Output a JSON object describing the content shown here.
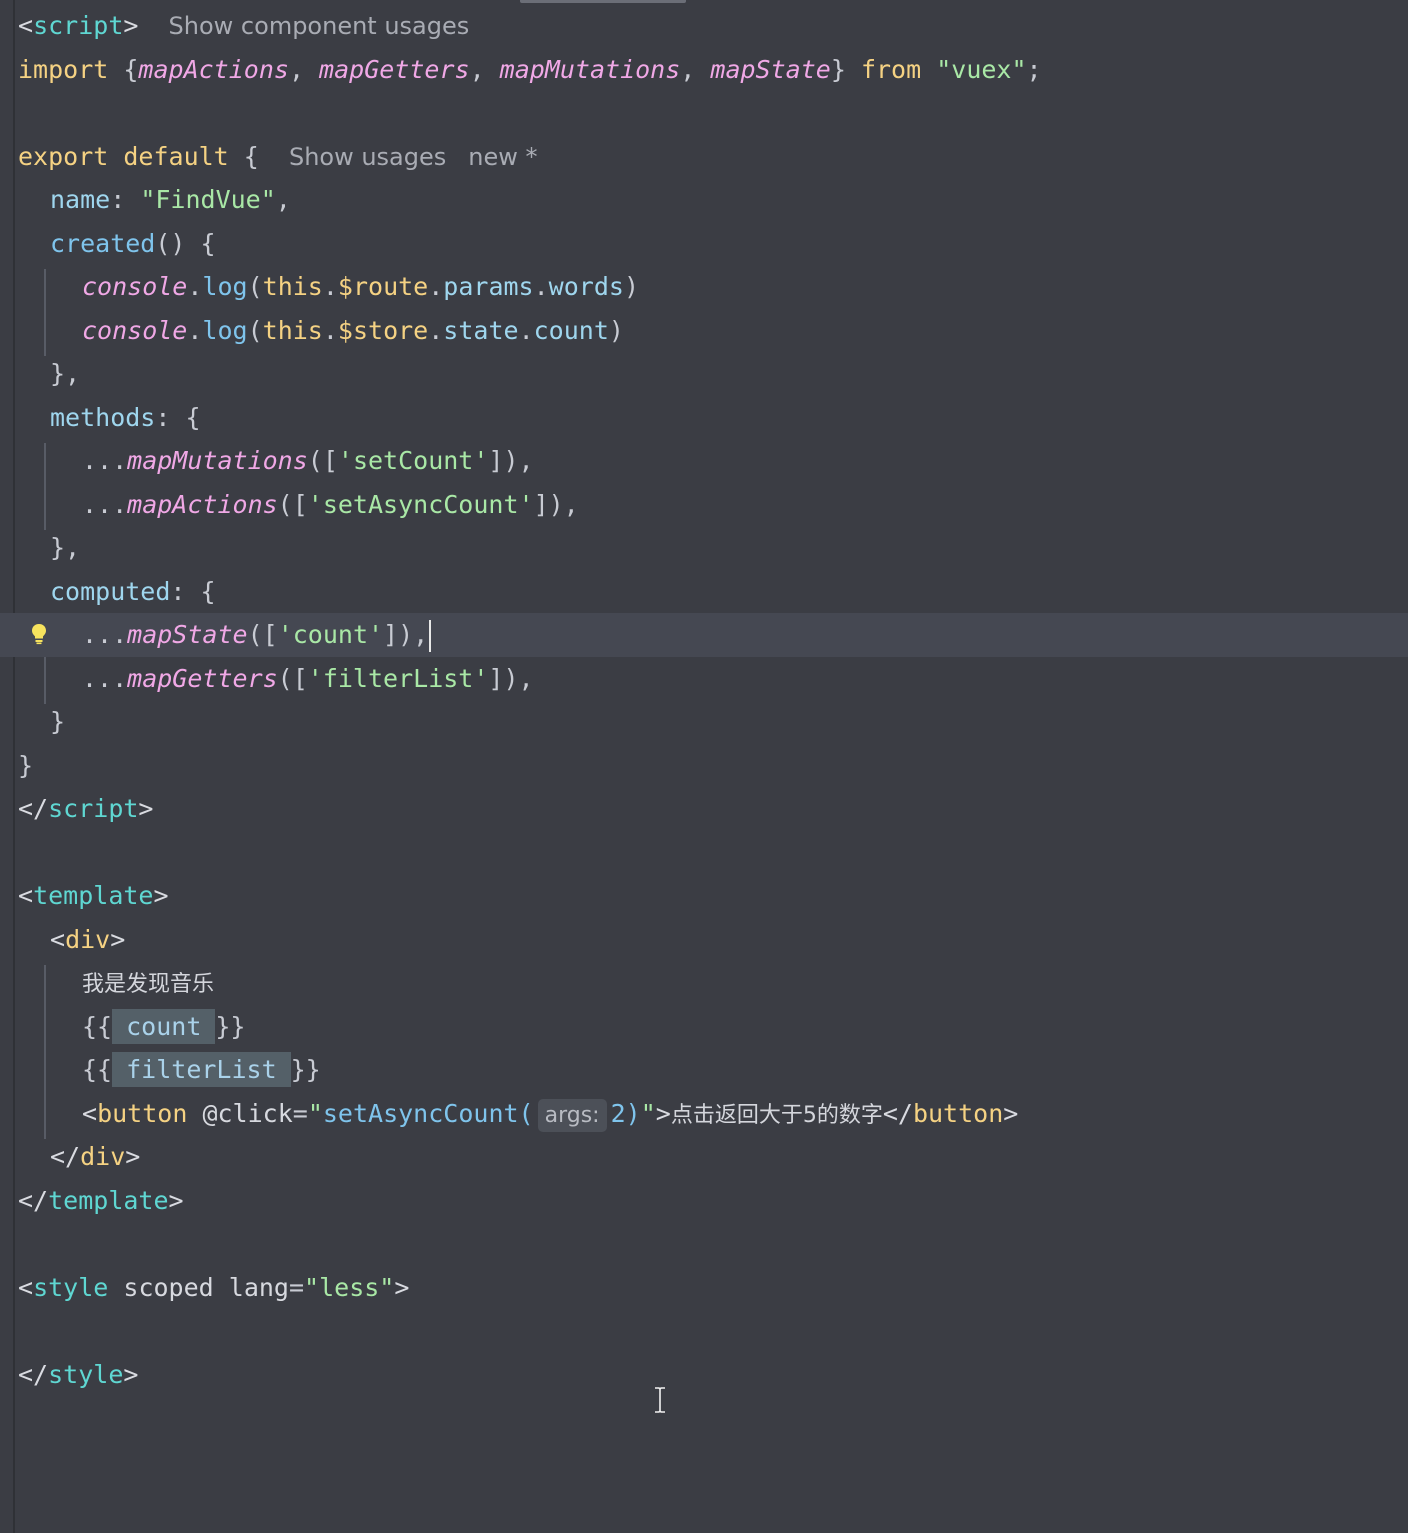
{
  "inlay_hints": {
    "script": "Show component usages",
    "export_usages": "Show usages",
    "export_new": "new *",
    "args_label": "args:"
  },
  "icons": {
    "lightbulb": "lightbulb-icon",
    "text_cursor": "i-beam-cursor-icon"
  },
  "colors": {
    "background": "#3b3d44",
    "current_line": "#454852",
    "tag": "#5fd7d2",
    "keyword": "#f5d283",
    "string": "#a9e8a6",
    "function_italic": "#f0a8e6",
    "property": "#9fd6ee",
    "lightbulb": "#f7e35e"
  },
  "code": {
    "l1_script_open": "script",
    "l2_import": "import",
    "l2_mapActions": "mapActions",
    "l2_mapGetters": "mapGetters",
    "l2_mapMutations": "mapMutations",
    "l2_mapState": "mapState",
    "l2_from": "from",
    "l2_module": "\"vuex\"",
    "l4_export": "export",
    "l4_default": "default",
    "l5_name_key": "name",
    "l5_name_value": "\"FindVue\"",
    "l6_created": "created",
    "l7_console": "console",
    "l7_log": "log",
    "l7_this": "this",
    "l7_route": "$route",
    "l7_params": "params",
    "l7_words": "words",
    "l8_console": "console",
    "l8_log": "log",
    "l8_this": "this",
    "l8_store": "$store",
    "l8_state": "state",
    "l8_count": "count",
    "l10_methods": "methods",
    "l11_mapMutations": "mapMutations",
    "l11_arg": "'setCount'",
    "l12_mapActions": "mapActions",
    "l12_arg": "'setAsyncCount'",
    "l14_computed": "computed",
    "l15_mapState": "mapState",
    "l15_arg": "'count'",
    "l16_mapGetters": "mapGetters",
    "l16_arg": "'filterList'",
    "l19_script_close": "script",
    "l21_template_open": "template",
    "l22_div_open": "div",
    "l23_text": "我是发现音乐",
    "l24_interp": "count",
    "l25_interp": "filterList",
    "l26_button_tag": "button",
    "l26_attr": "@click",
    "l26_handler": "setAsyncCount(",
    "l26_arg_value": "2",
    "l26_close_paren": ")",
    "l26_button_text": "点击返回大于5的数字",
    "l26_button_close": "button",
    "l27_div_close": "div",
    "l28_template_close": "template",
    "l30_style_tag": "style",
    "l30_scoped": "scoped",
    "l30_lang_attr": "lang",
    "l30_lang_value": "\"less\"",
    "l32_style_close": "style"
  }
}
